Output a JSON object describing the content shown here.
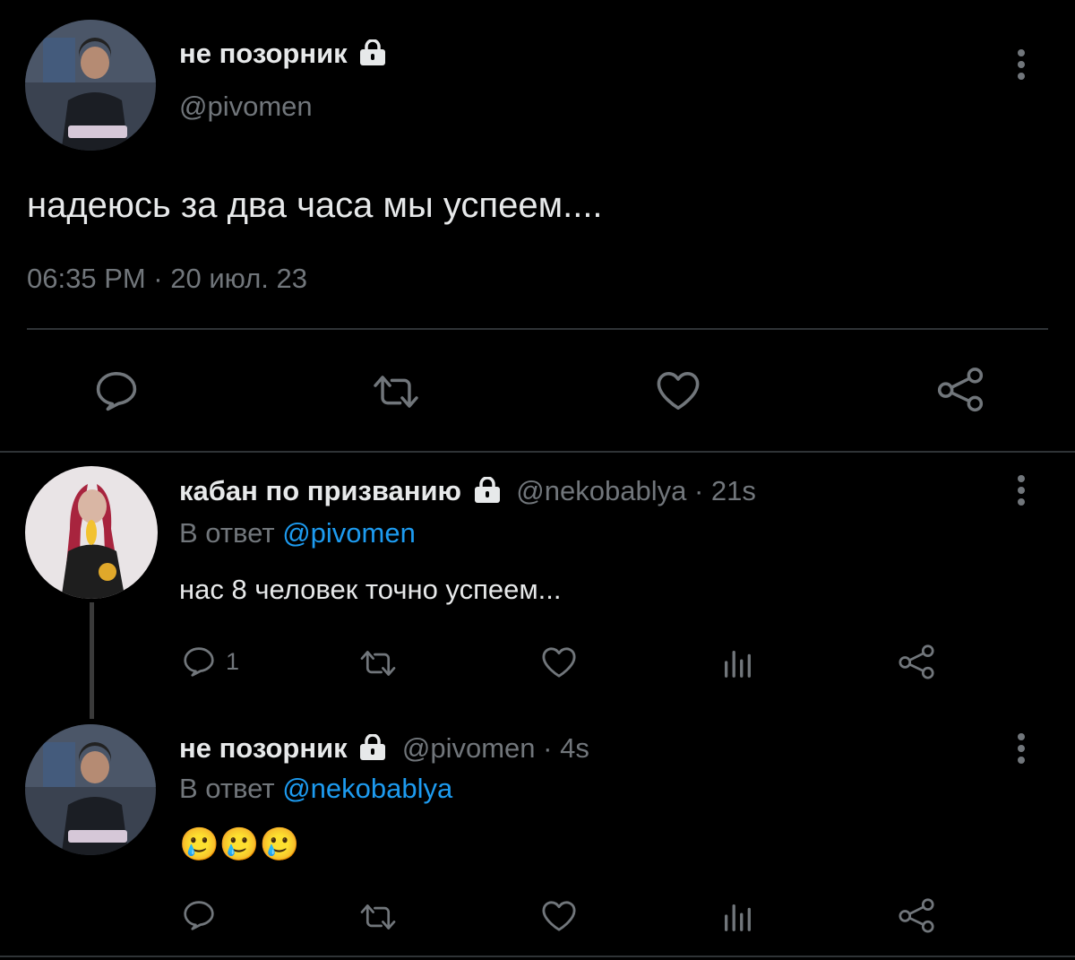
{
  "main_tweet": {
    "display_name": "не позорник",
    "handle": "@pivomen",
    "text": "надеюсь за два часа мы успеем....",
    "timestamp": "06:35 PM · 20 июл. 23",
    "actions": [
      "reply-icon",
      "retweet-icon",
      "like-icon",
      "share-icon"
    ]
  },
  "replies": [
    {
      "display_name": "кабан по призванию",
      "handle": "@nekobablya",
      "time": "· 21s",
      "reply_prefix": "В ответ",
      "reply_to": "@pivomen",
      "text": "нас 8 человек точно успеем...",
      "reply_count": "1"
    },
    {
      "display_name": "не позорник",
      "handle": "@pivomen",
      "time": "· 4s",
      "reply_prefix": "В ответ",
      "reply_to": "@nekobablya",
      "text": "🥲🥲🥲",
      "reply_count": ""
    }
  ],
  "colors": {
    "background": "#000000",
    "text": "#e7e9ea",
    "muted": "#71767b",
    "link": "#1d9bf0",
    "divider": "#2f3336"
  }
}
